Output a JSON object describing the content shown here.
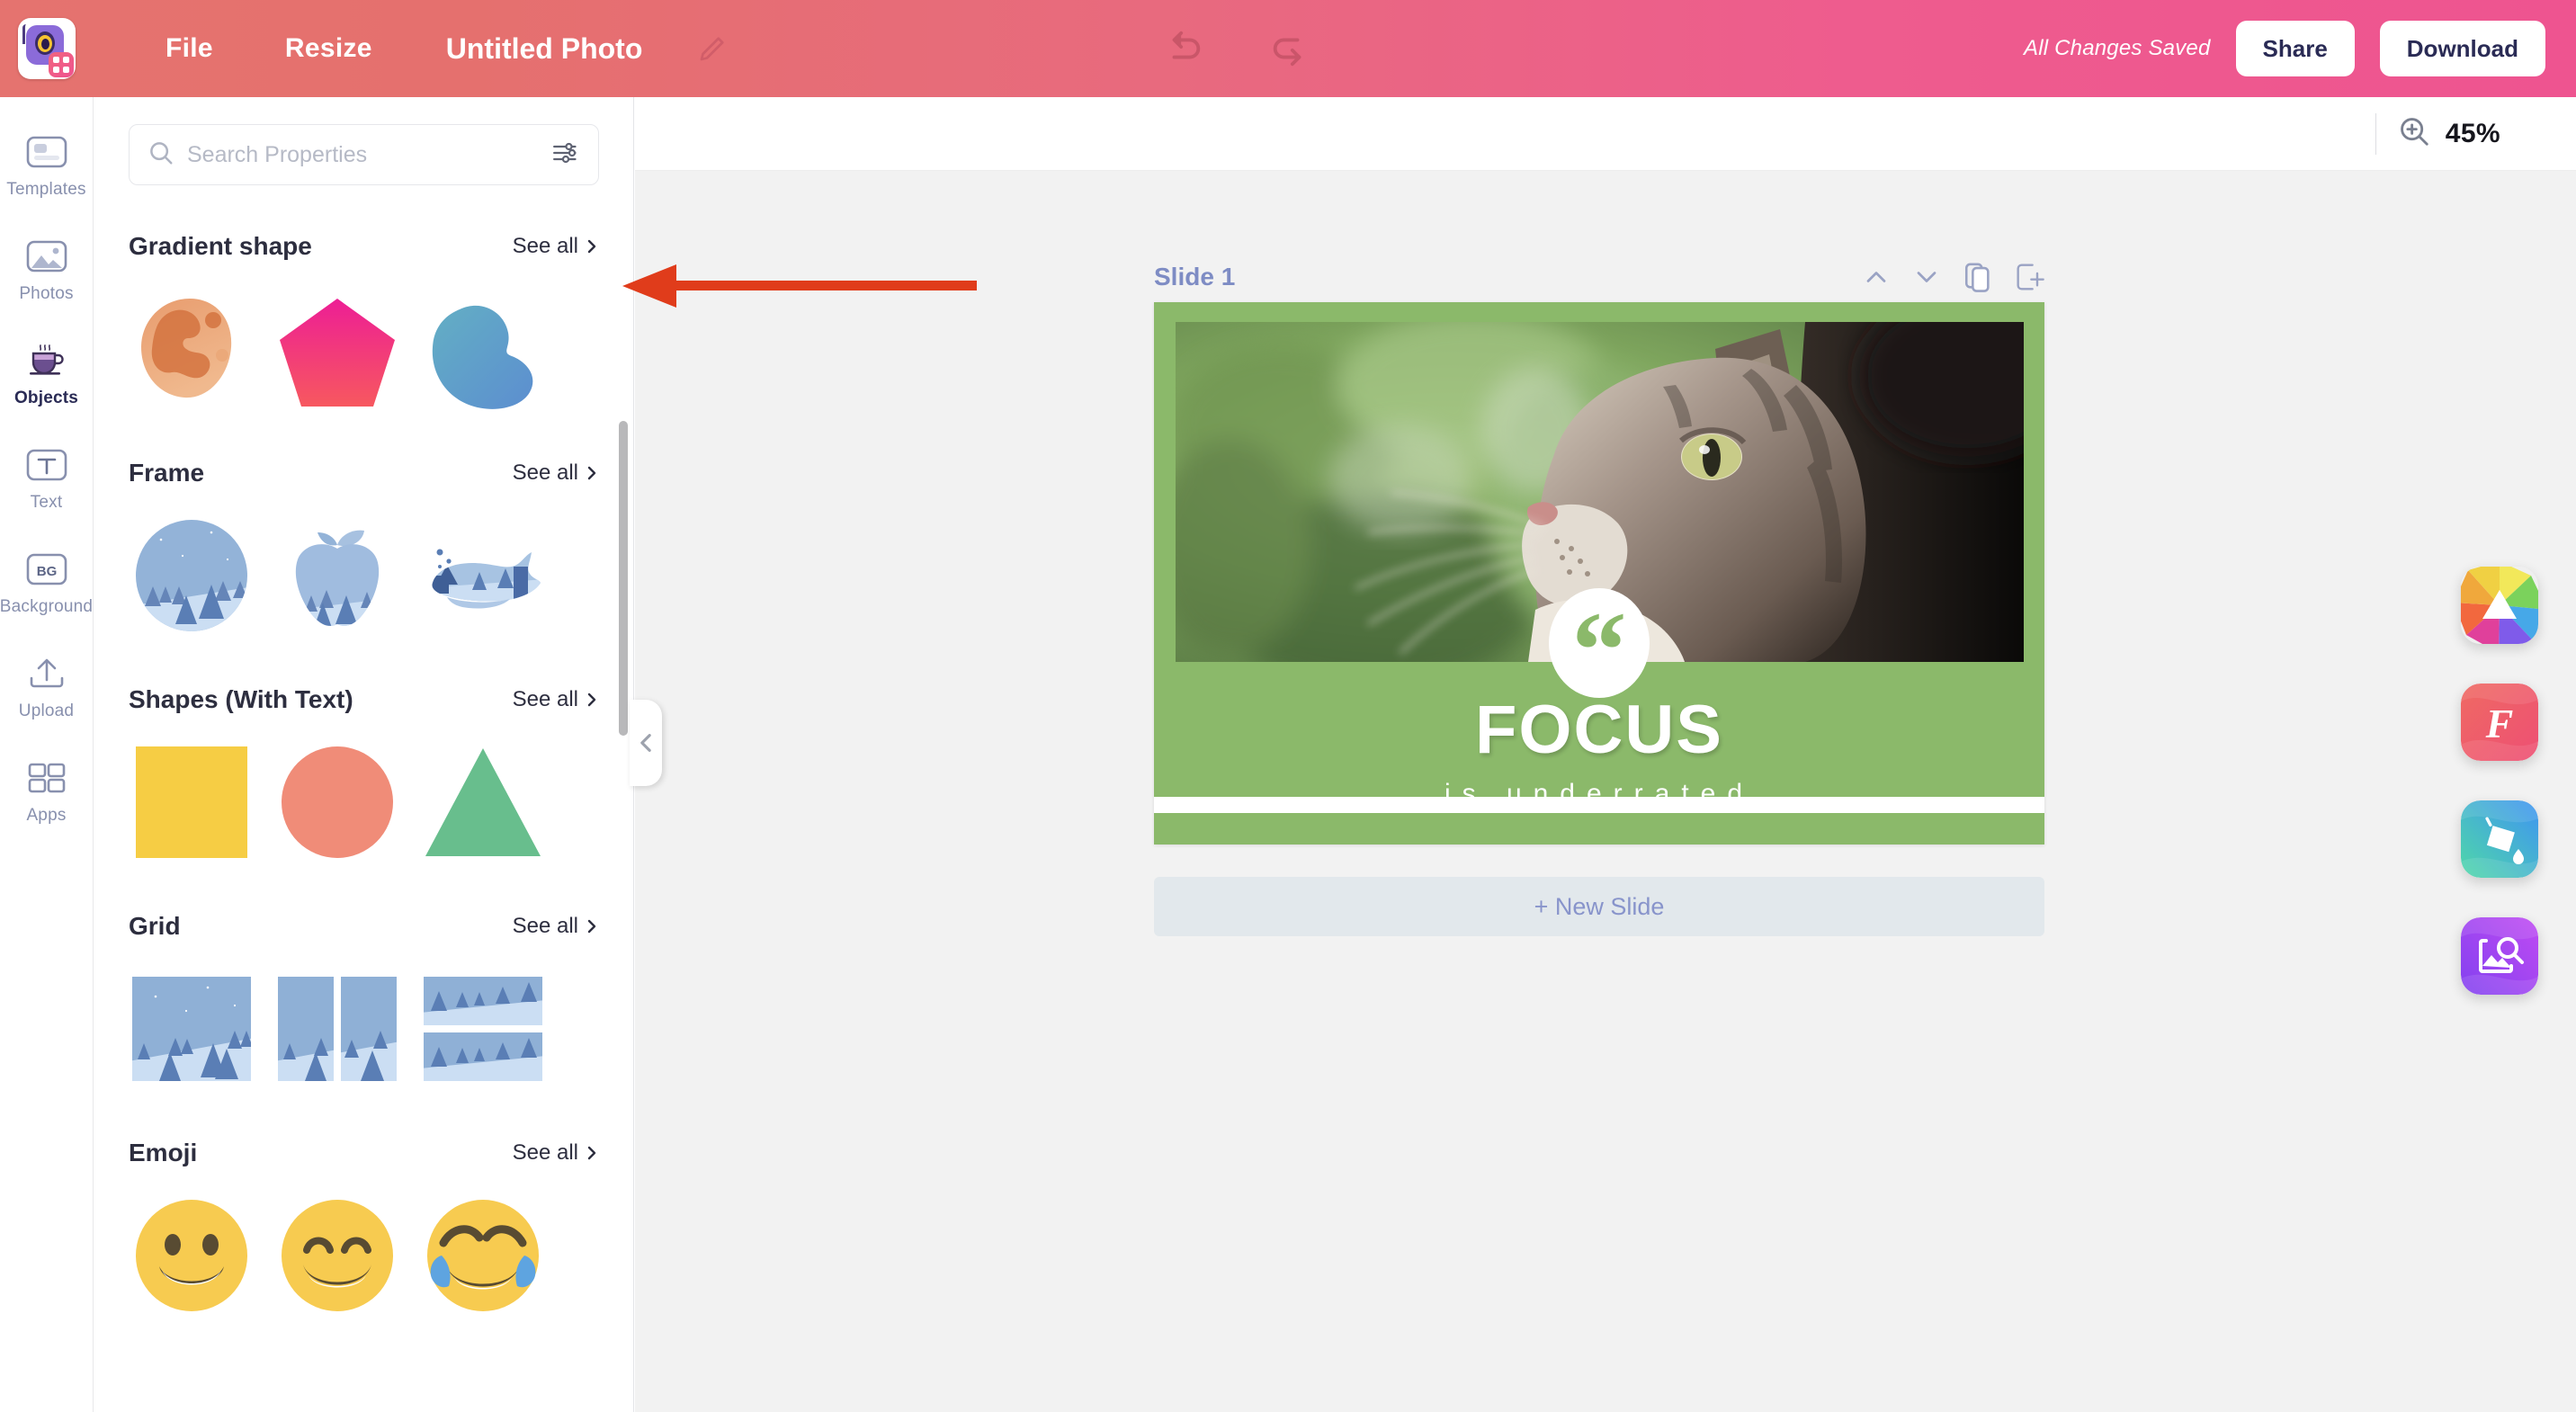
{
  "header": {
    "logo_icon": "camera-app-logo",
    "menu": [
      {
        "label": "File",
        "name": "file"
      },
      {
        "label": "Resize",
        "name": "resize"
      }
    ],
    "doc_title": "Untitled Photo",
    "edit_icon": "pencil-icon",
    "undo_icon": "undo-icon",
    "redo_icon": "redo-icon",
    "saved_status": "All Changes Saved",
    "share_label": "Share",
    "download_label": "Download",
    "bar_color_left": "#E5736F",
    "bar_color_right": "#EE5490"
  },
  "sidebar": {
    "items": [
      {
        "label": "Templates",
        "icon": "templates-icon",
        "active": false
      },
      {
        "label": "Photos",
        "icon": "photos-icon",
        "active": false
      },
      {
        "label": "Objects",
        "icon": "coffee-cup-icon",
        "active": true
      },
      {
        "label": "Text",
        "icon": "text-icon",
        "active": false
      },
      {
        "label": "Background",
        "icon": "background-bg-icon",
        "active": false
      },
      {
        "label": "Upload",
        "icon": "upload-icon",
        "active": false
      },
      {
        "label": "Apps",
        "icon": "apps-grid-icon",
        "active": false
      }
    ]
  },
  "panel": {
    "search": {
      "placeholder": "Search Properties",
      "value": "",
      "search_icon": "search-icon",
      "filter_icon": "sliders-filter-icon"
    },
    "see_all_label": "See all",
    "sections": [
      {
        "title": "Gradient shape",
        "name": "gradient-shape",
        "tiles": [
          "blob-orange-gradient",
          "pentagon-pink-gradient",
          "bean-blue-gradient"
        ]
      },
      {
        "title": "Frame",
        "name": "frame",
        "tiles": [
          "circle-forest-frame",
          "apple-forest-frame",
          "whale-forest-frame"
        ]
      },
      {
        "title": "Shapes (With Text)",
        "name": "shapes-with-text",
        "tiles": [
          "square-yellow",
          "circle-salmon",
          "triangle-green"
        ]
      },
      {
        "title": "Grid",
        "name": "grid",
        "tiles": [
          "grid-1-cell",
          "grid-2-columns",
          "grid-2-rows"
        ]
      },
      {
        "title": "Emoji",
        "name": "emoji",
        "tiles": [
          "grinning-face-emoji",
          "smiling-face-with-smiling-eyes-emoji",
          "face-with-tears-of-joy-emoji"
        ]
      }
    ],
    "collapse_icon": "chevron-left-icon"
  },
  "canvas": {
    "zoom": {
      "icon": "zoom-in-magnifier-icon",
      "value": "45%"
    },
    "slide": {
      "label": "Slide 1",
      "tools": [
        {
          "name": "move-up",
          "icon": "chevron-up-icon"
        },
        {
          "name": "move-down",
          "icon": "chevron-down-icon"
        },
        {
          "name": "duplicate-slide",
          "icon": "duplicate-icon"
        },
        {
          "name": "add-slide",
          "icon": "add-slide-icon"
        }
      ],
      "background_color": "#8BB96A",
      "photo_alt": "tabby-cat-looking-up",
      "quote_icon": "quote-mark-icon",
      "headline": "FOCUS",
      "subtitle": "is underrated"
    },
    "new_slide_label": "+ New Slide"
  },
  "float_apps": [
    {
      "name": "effects-app",
      "icon": "color-wheel-mountain-icon",
      "colors": [
        "#F5C542",
        "#8BD44E",
        "#49A9F0",
        "#A25BF0",
        "#EE4D8D",
        "#F07C3E"
      ]
    },
    {
      "name": "fonts-app",
      "icon": "script-f-icon",
      "color": "#EF5C63"
    },
    {
      "name": "fill-app",
      "icon": "paint-bucket-icon",
      "colors": [
        "#4FD8B6",
        "#4A9BF5"
      ]
    },
    {
      "name": "image-search-app",
      "icon": "image-search-icon",
      "colors": [
        "#8A4BF5",
        "#C44BF5"
      ]
    }
  ],
  "annotation": {
    "arrow_color": "#E03C1B",
    "target": "gradient-shape-see-all"
  }
}
